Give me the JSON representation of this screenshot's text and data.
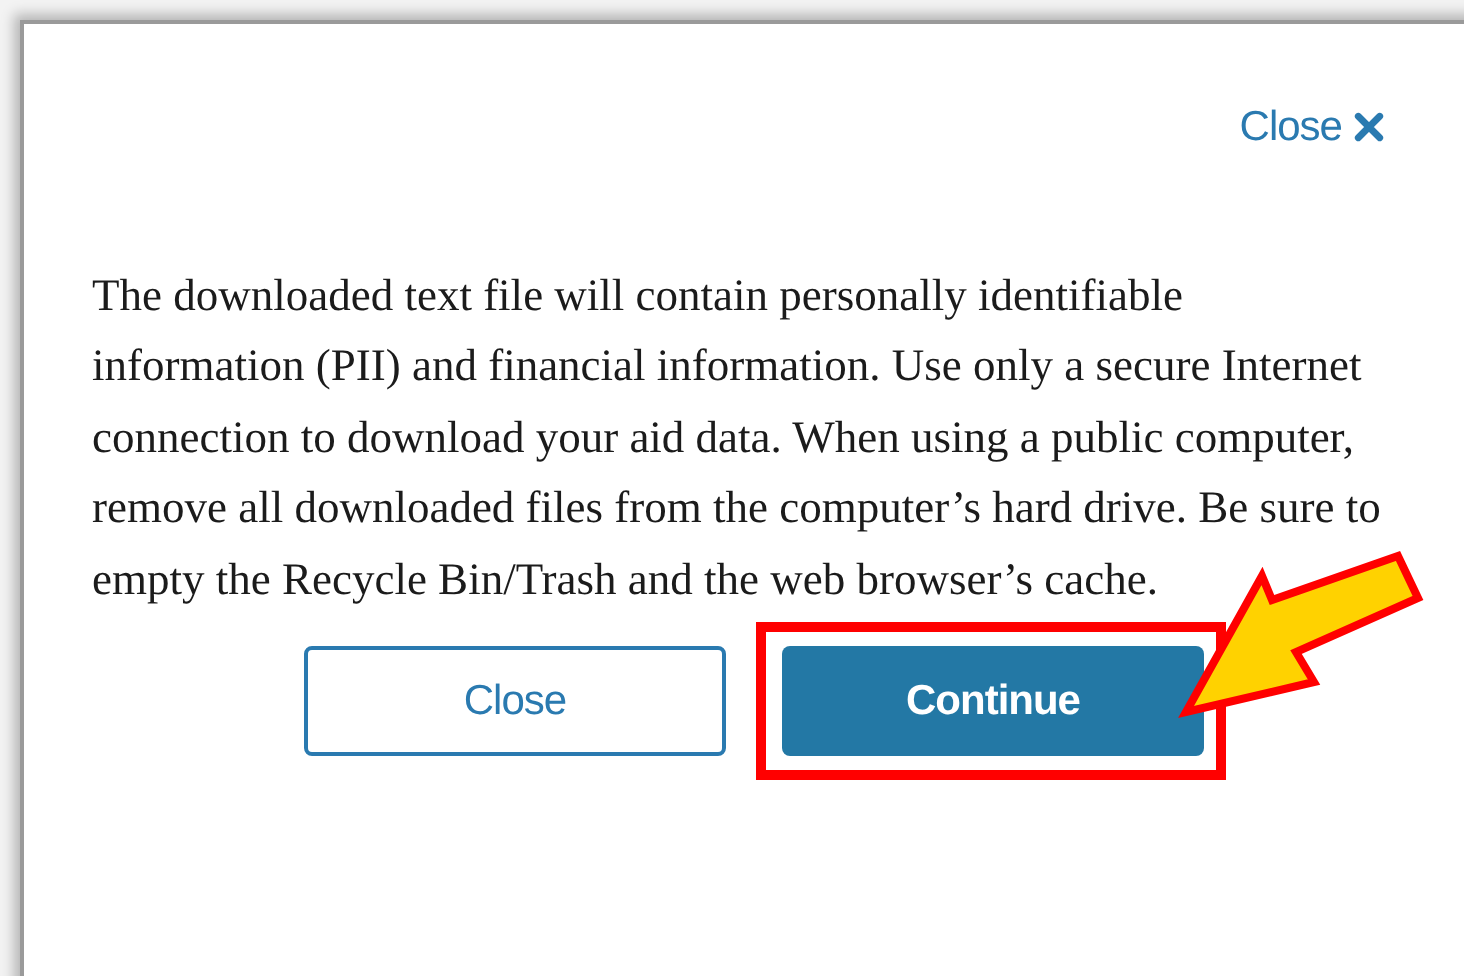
{
  "close_link": {
    "label": "Close"
  },
  "message": "The downloaded text file will contain personally identifiable information (PII) and financial information. Use only a secure Internet connection to download your aid data. When using a public computer, remove all downloaded files from the computer’s hard drive. Be sure to empty the Recycle Bin/Trash and the web browser’s cache.",
  "buttons": [
    {
      "label": "Close",
      "kind": "secondary",
      "highlighted": false
    },
    {
      "label": "Continue",
      "kind": "primary",
      "highlighted": true
    }
  ]
}
